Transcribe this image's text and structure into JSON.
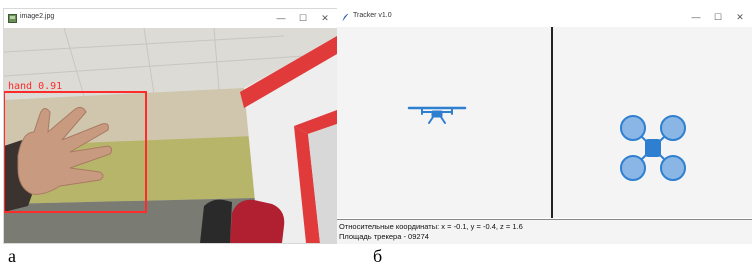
{
  "window_a": {
    "title": "image2.jpg",
    "controls": {
      "minimize": "—",
      "maximize": "☐",
      "close": "✕"
    },
    "detection": {
      "label": "hand 0.91",
      "color": "#ff2a2a"
    }
  },
  "window_b": {
    "title": "Tracker v1.0",
    "controls": {
      "minimize": "—",
      "maximize": "☐",
      "close": "✕"
    },
    "drone_color": "#2f7fd1",
    "status": {
      "coordinates": "Относительные координаты: x = -0.1, y = -0.4, z = 1.6",
      "tracker_area": "Площадь трекера - 09274"
    }
  },
  "captions": {
    "a": "а",
    "b": "б"
  }
}
